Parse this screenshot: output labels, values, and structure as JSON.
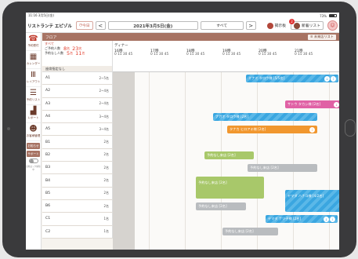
{
  "status": {
    "left": "11:16  3月5日(金)",
    "right": "73%"
  },
  "header": {
    "store_name": "リストランテ エピゾル",
    "today_label": "今日",
    "prev_arrow": "<",
    "date_label": "2021年3月5日(金)",
    "filter_value": "すべて",
    "next_arrow": ">",
    "notice_label": "掲示板",
    "reservation_list_label": "新着リスト",
    "notice_badge": "2"
  },
  "sidebar": {
    "items": [
      {
        "label": "予約受付",
        "icon": "phone-icon"
      },
      {
        "label": "カレンダー",
        "icon": "calendar-icon"
      },
      {
        "label": "レイアウト",
        "icon": "table-layout-icon"
      },
      {
        "label": "予約リスト",
        "icon": "list-icon"
      },
      {
        "label": "レポート",
        "icon": "chart-icon"
      },
      {
        "label": "お客様管理",
        "icon": "customers-icon"
      }
    ],
    "notice_btn": "お知らせ",
    "support_btn": "サポート",
    "toggle_caption": "自動ロック解除中"
  },
  "floor": {
    "label": "フロア",
    "list_button": "≡ 未来店リスト"
  },
  "summary": {
    "all_label": "すべて",
    "rows": [
      {
        "label": "ご予約人数",
        "value1": "8",
        "unit1": "名",
        "value2": "23",
        "unit2": "名"
      },
      {
        "label": "予約なし人数",
        "value1": "5",
        "unit1": "名",
        "value2": "11",
        "unit2": "名"
      }
    ],
    "no_floor": "座席指定なし"
  },
  "timeline": {
    "period": "ディナー",
    "hours": [
      "16時",
      "17時",
      "18時",
      "19時",
      "20時",
      "21時"
    ],
    "minute_ticks": "0  15  30  45"
  },
  "tables": [
    {
      "name": "A1",
      "cap": "2~5名"
    },
    {
      "name": "A2",
      "cap": "2~4名"
    },
    {
      "name": "A3",
      "cap": "2~4名"
    },
    {
      "name": "A4",
      "cap": "3~4名"
    },
    {
      "name": "A5",
      "cap": "3~4名"
    },
    {
      "name": "B1",
      "cap": "2名"
    },
    {
      "name": "B2",
      "cap": "2名"
    },
    {
      "name": "B3",
      "cap": "2名"
    },
    {
      "name": "B4",
      "cap": "2名"
    },
    {
      "name": "B5",
      "cap": "2名"
    },
    {
      "name": "B6",
      "cap": "2名"
    },
    {
      "name": "C1",
      "cap": "1名"
    },
    {
      "name": "C2",
      "cap": "1名"
    }
  ],
  "reservations": [
    {
      "label": "ミナミ タロウ様 [5/5名]",
      "color": "#3aa6e0",
      "icons": [
        "↓",
        "i"
      ]
    },
    {
      "label": "サトウ タカシ様 [2名]",
      "color": "#e061a5",
      "icons": [
        "↓",
        "✎",
        "i"
      ]
    },
    {
      "label": "ナガオ タロウ様 [2名]",
      "color": "#3aa6e0",
      "icons": []
    },
    {
      "label": "タナカ ヒロアキ様 [2名]",
      "color": "#f1972f",
      "icons": [
        "i"
      ]
    },
    {
      "label": "予約なし来店 [2名]",
      "color": "#a8c86a",
      "icons": []
    },
    {
      "label": "予約なし来店 [2名]",
      "color": "#b9bcbf",
      "icons": []
    },
    {
      "label": "予約なし来店 [2名]",
      "color": "#a8c86a",
      "icons": []
    },
    {
      "label": "予約なし来店 [2名]",
      "color": "#b9bcbf",
      "icons": []
    },
    {
      "label": "ヤマダ ハナコ様 [4/2名]",
      "color": "#3aa6e0",
      "icons": []
    },
    {
      "label": "ヤマダ ナツ子様 [2名]",
      "color": "#3aa6e0",
      "icons": [
        "↓",
        "i"
      ]
    },
    {
      "label": "予約なし来店 [2名]",
      "color": "#b9bcbf",
      "icons": []
    }
  ]
}
